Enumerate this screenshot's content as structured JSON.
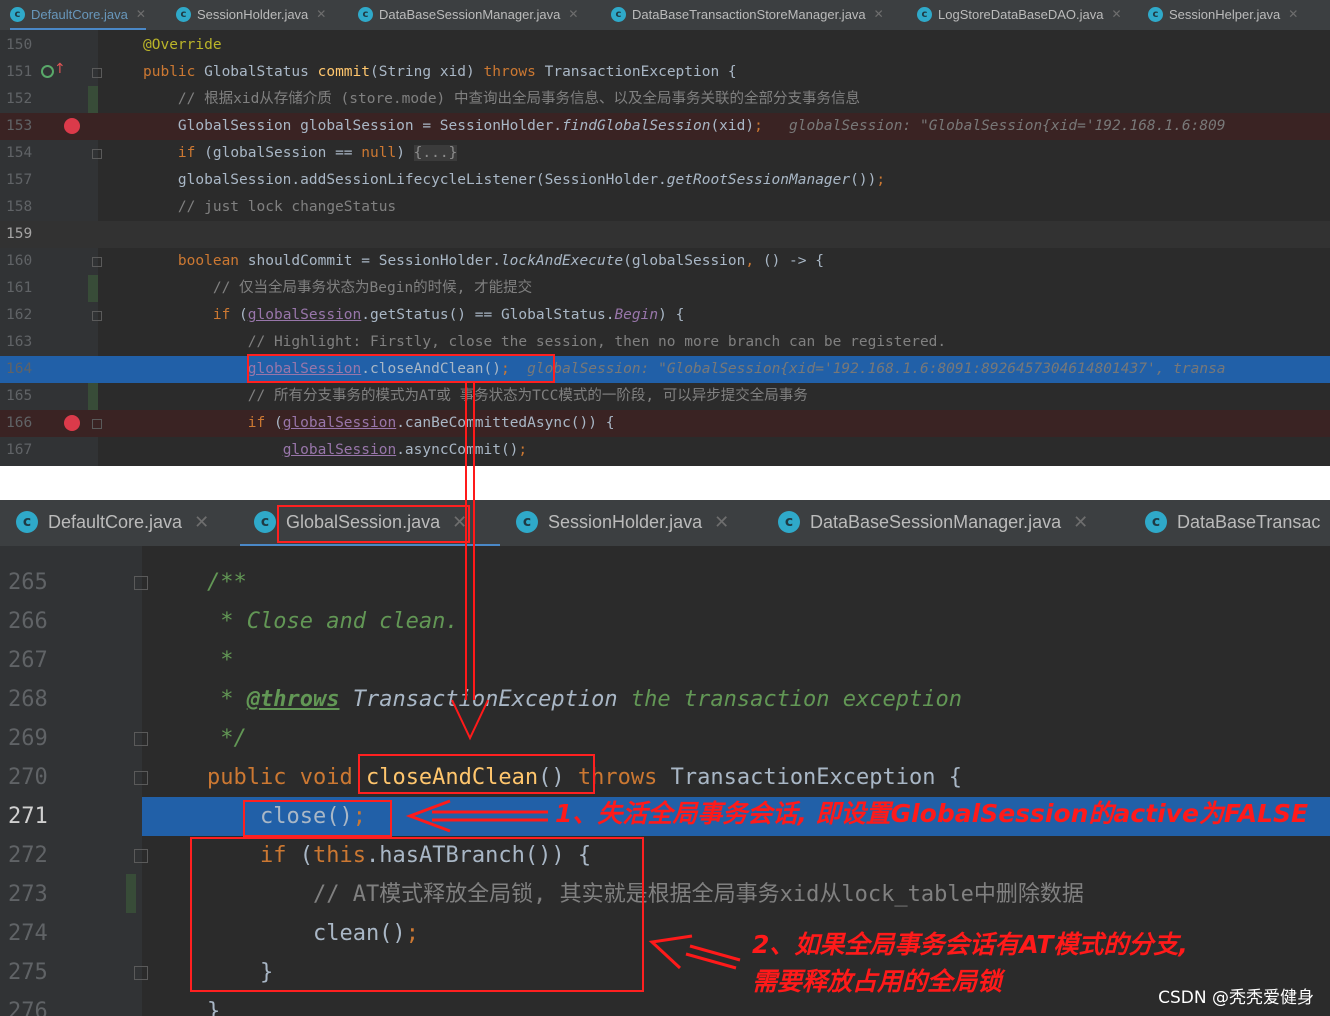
{
  "top_editor": {
    "tabs": [
      {
        "label": "DefaultCore.java"
      },
      {
        "label": "SessionHolder.java"
      },
      {
        "label": "DataBaseSessionManager.java"
      },
      {
        "label": "DataBaseTransactionStoreManager.java"
      },
      {
        "label": "LogStoreDataBaseDAO.java"
      },
      {
        "label": "SessionHelper.java"
      }
    ],
    "lines": [
      {
        "num": "150",
        "parts": [
          {
            "t": "@Override",
            "c": "ann"
          }
        ]
      },
      {
        "num": "151",
        "parts": [
          {
            "t": "public ",
            "c": "kw"
          },
          {
            "t": "GlobalStatus "
          },
          {
            "t": "commit",
            "c": "fn"
          },
          {
            "t": "(String xid) "
          },
          {
            "t": "throws ",
            "c": "kw"
          },
          {
            "t": "TransactionException {"
          }
        ]
      },
      {
        "num": "152",
        "parts": [
          {
            "t": "    // 根据xid从存储介质 (store.mode) 中查询出全局事务信息、以及全局事务关联的全部分支事务信息",
            "c": "cm"
          }
        ]
      },
      {
        "num": "153",
        "parts": [
          {
            "t": "    GlobalSession globalSession = SessionHolder."
          },
          {
            "t": "findGlobalSession",
            "c": "it"
          },
          {
            "t": "(xid)"
          },
          {
            "t": ";",
            "c": "kw"
          },
          {
            "t": "   globalSession: \"GlobalSession{xid='192.168.1.6:809",
            "c": "hint"
          }
        ]
      },
      {
        "num": "154",
        "parts": [
          {
            "t": "    "
          },
          {
            "t": "if ",
            "c": "kw"
          },
          {
            "t": "(globalSession == "
          },
          {
            "t": "null",
            "c": "kw"
          },
          {
            "t": ") "
          },
          {
            "t": "{...}",
            "c": "fold"
          }
        ]
      },
      {
        "num": "157",
        "parts": [
          {
            "t": "    globalSession.addSessionLifecycleListener(SessionHolder."
          },
          {
            "t": "getRootSessionManager",
            "c": "it"
          },
          {
            "t": "())"
          },
          {
            "t": ";",
            "c": "kw"
          }
        ]
      },
      {
        "num": "158",
        "parts": [
          {
            "t": "    // just lock changeStatus",
            "c": "cm"
          }
        ]
      },
      {
        "num": "159",
        "parts": []
      },
      {
        "num": "160",
        "parts": [
          {
            "t": "    "
          },
          {
            "t": "boolean ",
            "c": "kw"
          },
          {
            "t": "shouldCommit = SessionHolder."
          },
          {
            "t": "lockAndExecute",
            "c": "it"
          },
          {
            "t": "(globalSession"
          },
          {
            "t": ",",
            "c": "kw"
          },
          {
            "t": " () -> {"
          }
        ]
      },
      {
        "num": "161",
        "parts": [
          {
            "t": "        // 仅当全局事务状态为Begin的时候, 才能提交",
            "c": "cm"
          }
        ]
      },
      {
        "num": "162",
        "parts": [
          {
            "t": "        "
          },
          {
            "t": "if ",
            "c": "kw"
          },
          {
            "t": "("
          },
          {
            "t": "globalSession",
            "c": "fld"
          },
          {
            "t": ".getStatus() == GlobalStatus."
          },
          {
            "t": "Begin",
            "c": "st"
          },
          {
            "t": ") {"
          }
        ]
      },
      {
        "num": "163",
        "parts": [
          {
            "t": "            // Highlight: Firstly, close the session, then no more branch can be registered.",
            "c": "cm"
          }
        ]
      },
      {
        "num": "164",
        "parts": [
          {
            "t": "            "
          },
          {
            "t": "globalSession",
            "c": "fld"
          },
          {
            "t": ".closeAndClean()"
          },
          {
            "t": ";",
            "c": "kw"
          },
          {
            "t": "  globalSession: \"GlobalSession{xid='192.168.1.6:8091:8926457304614801437', transa",
            "c": "hint"
          }
        ]
      },
      {
        "num": "165",
        "parts": [
          {
            "t": "            // 所有分支事务的模式为AT或 事务状态为TCC模式的一阶段, 可以异步提交全局事务",
            "c": "cm"
          }
        ]
      },
      {
        "num": "166",
        "parts": [
          {
            "t": "            "
          },
          {
            "t": "if ",
            "c": "kw"
          },
          {
            "t": "("
          },
          {
            "t": "globalSession",
            "c": "fld"
          },
          {
            "t": ".canBeCommittedAsync()) {"
          }
        ]
      },
      {
        "num": "167",
        "parts": [
          {
            "t": "                "
          },
          {
            "t": "globalSession",
            "c": "fld"
          },
          {
            "t": ".asyncCommit()"
          },
          {
            "t": ";",
            "c": "kw"
          }
        ]
      }
    ]
  },
  "bottom_editor": {
    "tabs": [
      {
        "label": "DefaultCore.java"
      },
      {
        "label": "GlobalSession.java"
      },
      {
        "label": "SessionHolder.java"
      },
      {
        "label": "DataBaseSessionManager.java"
      },
      {
        "label": "DataBaseTransac"
      }
    ],
    "lines": [
      {
        "num": "265",
        "parts": [
          {
            "t": "/**",
            "c": "doc"
          }
        ]
      },
      {
        "num": "266",
        "parts": [
          {
            "t": " * Close and clean.",
            "c": "doc"
          }
        ]
      },
      {
        "num": "267",
        "parts": [
          {
            "t": " *",
            "c": "doc"
          }
        ]
      },
      {
        "num": "268",
        "parts": [
          {
            "t": " * ",
            "c": "doc"
          },
          {
            "t": "@throws",
            "c": "doctag"
          },
          {
            "t": " TransactionException",
            "c": "docref"
          },
          {
            "t": " the transaction exception",
            "c": "doc"
          }
        ]
      },
      {
        "num": "269",
        "parts": [
          {
            "t": " */",
            "c": "doc"
          }
        ]
      },
      {
        "num": "270",
        "parts": [
          {
            "t": "public ",
            "c": "kw"
          },
          {
            "t": "void ",
            "c": "kw"
          },
          {
            "t": "closeAndClean",
            "c": "fn"
          },
          {
            "t": "() "
          },
          {
            "t": "throws ",
            "c": "kw"
          },
          {
            "t": "TransactionException {"
          }
        ]
      },
      {
        "num": "271",
        "parts": [
          {
            "t": "    close()"
          },
          {
            "t": ";",
            "c": "kw"
          }
        ]
      },
      {
        "num": "272",
        "parts": [
          {
            "t": "    "
          },
          {
            "t": "if ",
            "c": "kw"
          },
          {
            "t": "("
          },
          {
            "t": "this",
            "c": "kw"
          },
          {
            "t": ".hasATBranch()) {"
          }
        ]
      },
      {
        "num": "273",
        "parts": [
          {
            "t": "        // AT模式释放全局锁, 其实就是根据全局事务xid从lock_table中删除数据",
            "c": "cm"
          }
        ]
      },
      {
        "num": "274",
        "parts": [
          {
            "t": "        clean()"
          },
          {
            "t": ";",
            "c": "kw"
          }
        ]
      },
      {
        "num": "275",
        "parts": [
          {
            "t": "    }"
          }
        ]
      },
      {
        "num": "276",
        "parts": [
          {
            "t": "}"
          }
        ]
      }
    ],
    "annotation_1": "1、失活全局事务会话, 即设置GlobalSession的active为FALSE",
    "annotation_2_line1": "2、如果全局事务会话有AT模式的分支,",
    "annotation_2_line2": "需要释放占用的全局锁"
  },
  "watermark": "CSDN @秃秃爱健身",
  "colors": {
    "annotation_red": "#ff1a1a",
    "selection_blue": "#2160a8",
    "editor_bg": "#2b2b2b"
  }
}
